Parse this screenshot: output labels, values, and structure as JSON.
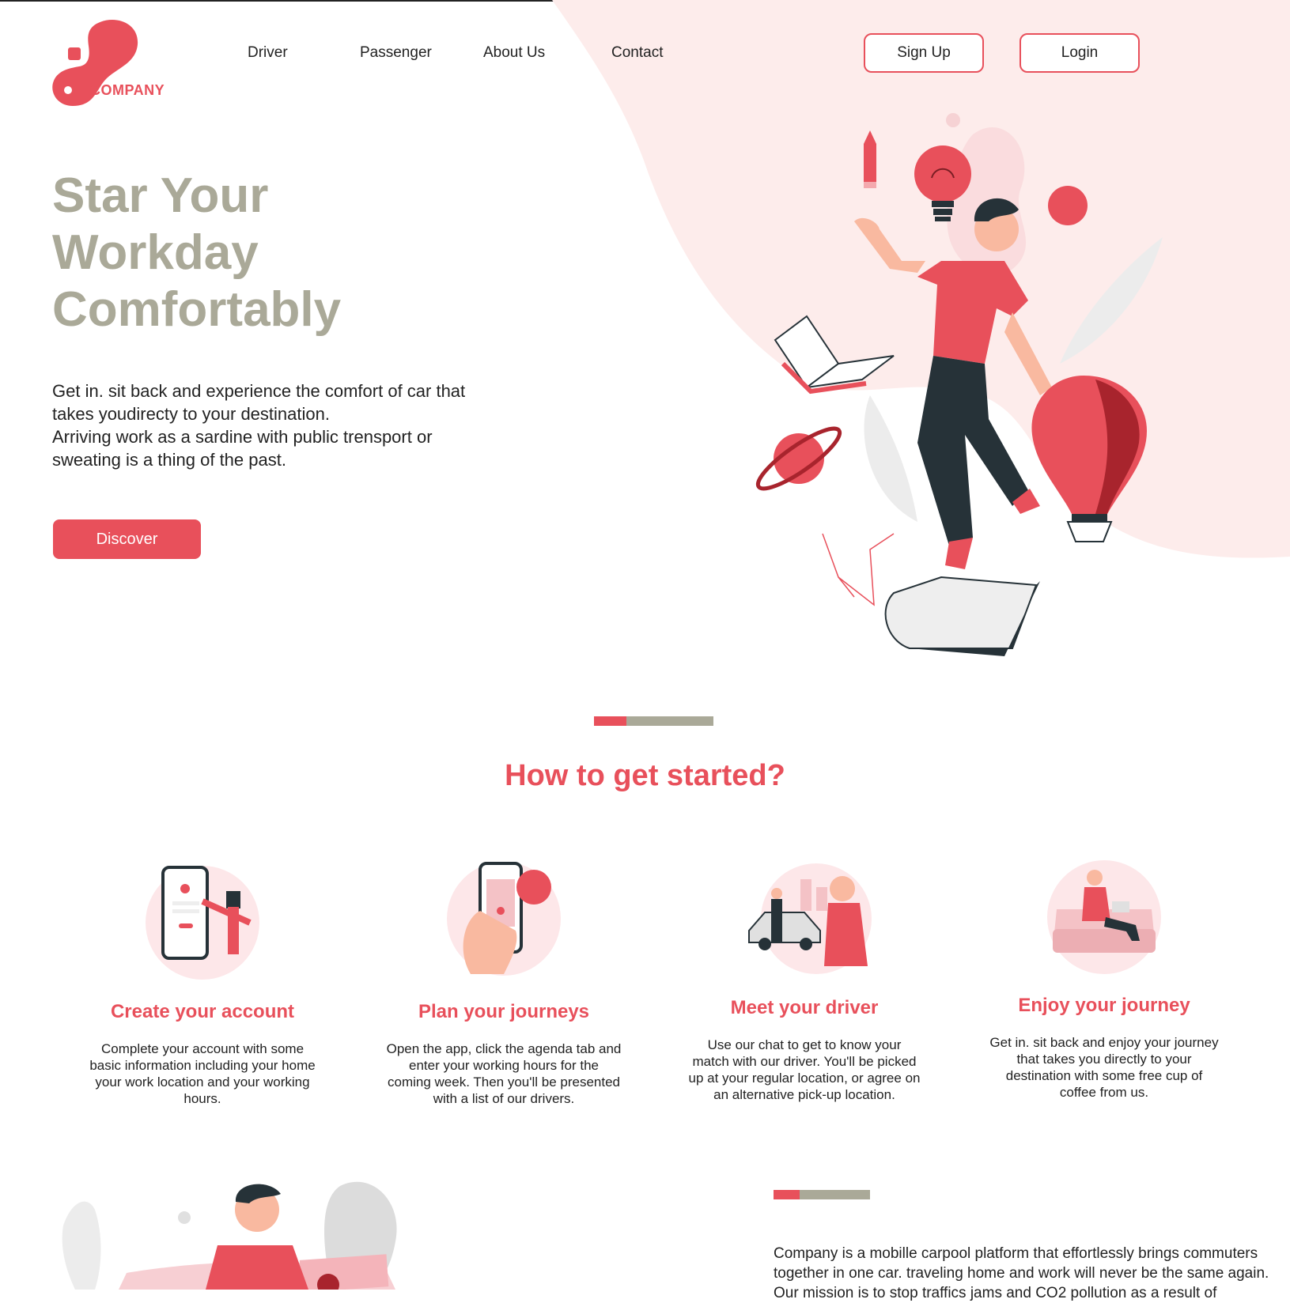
{
  "brand": {
    "logo_text": "COMPANY",
    "accent": "#e8505b",
    "muted": "#aaa998",
    "blush": "#fdeceb"
  },
  "nav": {
    "items": [
      "Driver",
      "Passenger",
      "About Us",
      "Contact"
    ]
  },
  "auth": {
    "signup_label": "Sign Up",
    "login_label": "Login"
  },
  "hero": {
    "title_lines": [
      "Star Your",
      "Workday",
      "Comfortably"
    ],
    "description_lines": [
      "Get in. sit back and experience the comfort of car that",
      "takes youdirecty to your destination.",
      "Arriving work as a sardine with public trensport or",
      "sweating is a thing of the past."
    ],
    "cta_label": "Discover"
  },
  "how_to": {
    "title": "How to get started?",
    "steps": [
      {
        "title": "Create your account",
        "icon": "signup-phone-icon",
        "lines": [
          "Complete your account with some",
          "basic information including your home",
          "your work location and your working",
          "hours."
        ]
      },
      {
        "title": "Plan your journeys",
        "icon": "map-phone-icon",
        "lines": [
          "Open the app, click the agenda tab and",
          "enter your working hours for the",
          "coming week. Then you'll be presented",
          "with a list of our drivers."
        ]
      },
      {
        "title": "Meet your driver",
        "icon": "driver-car-icon",
        "lines": [
          "Use our chat to get to know your",
          "match with our driver. You'll be picked",
          "up at your regular location, or agree on",
          "an alternative pick-up location."
        ]
      },
      {
        "title": "Enjoy your journey",
        "icon": "relax-sofa-icon",
        "lines": [
          "Get in. sit back and enjoy your journey",
          "that takes you directly to your",
          "destination with some free cup of",
          "coffee from us."
        ]
      }
    ]
  },
  "about": {
    "lines": [
      "Company is a mobille carpool platform that effortlessly brings commuters",
      "together in one car. traveling home and work will never be the same again.",
      "Our mission is to stop traffics jams and CO2 pollution as a result of"
    ]
  }
}
